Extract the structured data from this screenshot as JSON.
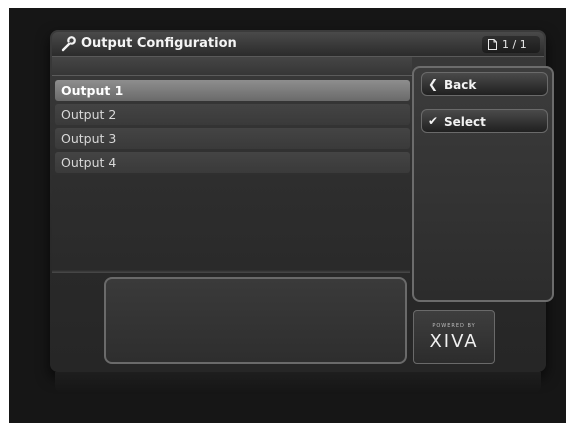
{
  "window": {
    "title": "Output Configuration",
    "pager": "1 / 1"
  },
  "outputs": [
    {
      "label": "Output 1",
      "selected": true
    },
    {
      "label": "Output 2",
      "selected": false
    },
    {
      "label": "Output 3",
      "selected": false
    },
    {
      "label": "Output 4",
      "selected": false
    }
  ],
  "actions": {
    "back_label": "Back",
    "select_label": "Select"
  },
  "logo": {
    "powered_by": "POWERED BY",
    "brand": "XIVA"
  },
  "icons": {
    "title": "wrench-icon",
    "pager": "document-icon",
    "back": "chevron-left-icon",
    "select": "checkmark-icon"
  }
}
